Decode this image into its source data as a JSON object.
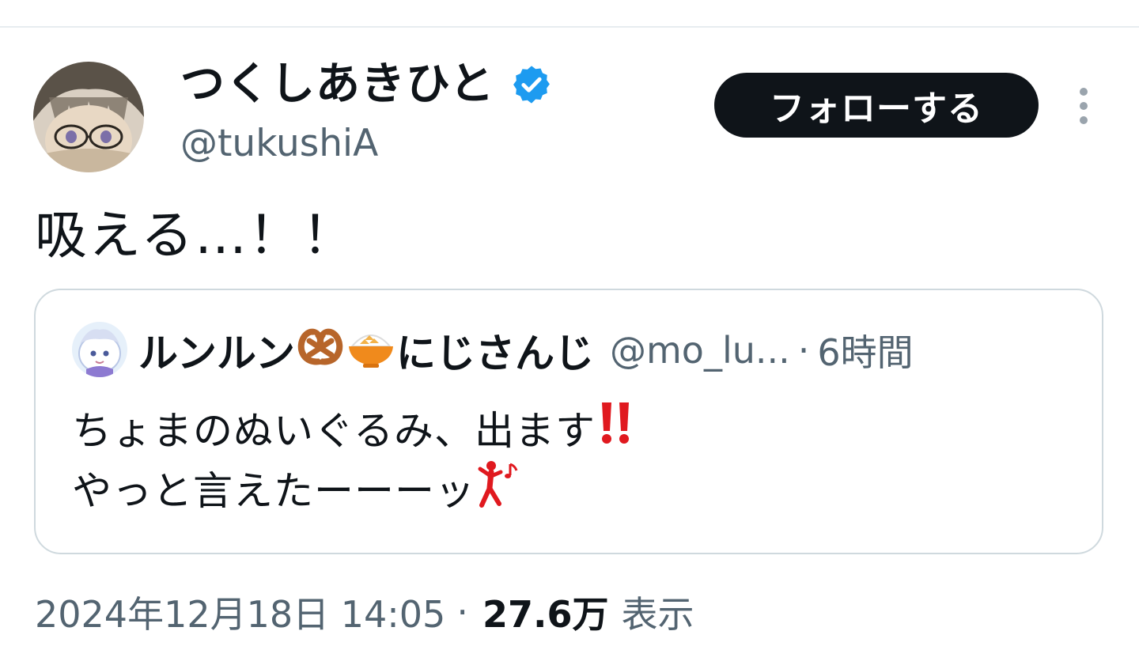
{
  "tweet": {
    "author": {
      "display_name": "つくしあきひと",
      "handle": "@tukushiA",
      "verified": true
    },
    "follow_label": "フォローする",
    "text": "吸える…！！",
    "quote": {
      "name_part1": "ルンルン",
      "name_part2": "にじさんじ",
      "handle": "@mo_lu...",
      "separator": "·",
      "time": "6時間",
      "line1": "ちょまのぬいぐるみ、出ます",
      "line2": "やっと言えたーーーッ"
    },
    "date": "2024年12月18日 14:05",
    "separator": "·",
    "views": "27.6万",
    "views_label": "表示"
  },
  "colors": {
    "verified": "#1d9bf0",
    "secondary_text": "#536471",
    "primary_text": "#0f1419",
    "border": "#cfd9de",
    "exclamation": "#e0191f",
    "dancer": "#e0191f"
  },
  "icons": {
    "verified": "verified-badge-icon",
    "more": "more-vertical-icon",
    "pretzel": "pretzel-emoji",
    "rice": "rice-bowl-emoji",
    "exclamation": "double-exclamation-emoji",
    "dancer": "dancer-emoji"
  }
}
